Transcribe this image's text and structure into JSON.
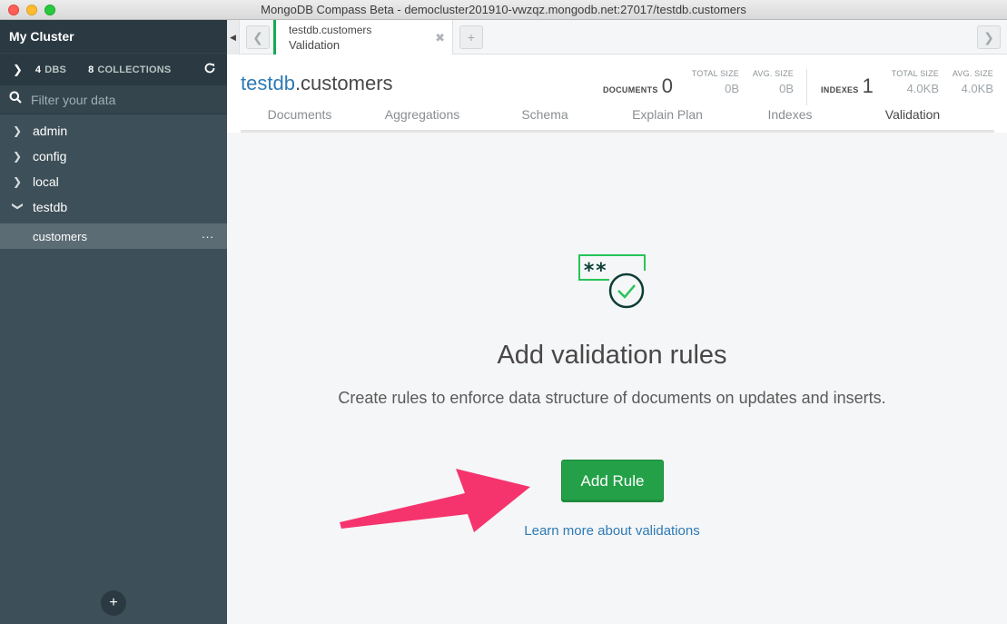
{
  "window": {
    "title": "MongoDB Compass Beta - democluster201910-vwzqz.mongodb.net:27017/testdb.customers"
  },
  "sidebar": {
    "cluster_name": "My Cluster",
    "dbs_count": "4",
    "dbs_label": "DBS",
    "collections_count": "8",
    "collections_label": "COLLECTIONS",
    "filter_placeholder": "Filter your data",
    "databases": [
      "admin",
      "config",
      "local",
      "testdb"
    ],
    "active_collection": "customers",
    "active_collection_menu": "..."
  },
  "tab": {
    "namespace": "testdb.customers",
    "subtitle": "Validation"
  },
  "collection": {
    "db": "testdb",
    "name": ".customers",
    "documents_label": "DOCUMENTS",
    "documents_count": "0",
    "doc_total_size_label": "TOTAL SIZE",
    "doc_total_size": "0B",
    "doc_avg_size_label": "AVG. SIZE",
    "doc_avg_size": "0B",
    "indexes_label": "INDEXES",
    "indexes_count": "1",
    "idx_total_size_label": "TOTAL SIZE",
    "idx_total_size": "4.0KB",
    "idx_avg_size_label": "AVG. SIZE",
    "idx_avg_size": "4.0KB"
  },
  "tabs": [
    "Documents",
    "Aggregations",
    "Schema",
    "Explain Plan",
    "Indexes",
    "Validation"
  ],
  "main": {
    "title": "Add validation rules",
    "description": "Create rules to enforce data structure of documents on updates and inserts.",
    "button_label": "Add Rule",
    "link_label": "Learn more about validations"
  },
  "colors": {
    "accent_green": "#13aa52",
    "button_green": "#24a148",
    "link_blue": "#2e7ab5",
    "arrow_pink": "#f5346e"
  }
}
